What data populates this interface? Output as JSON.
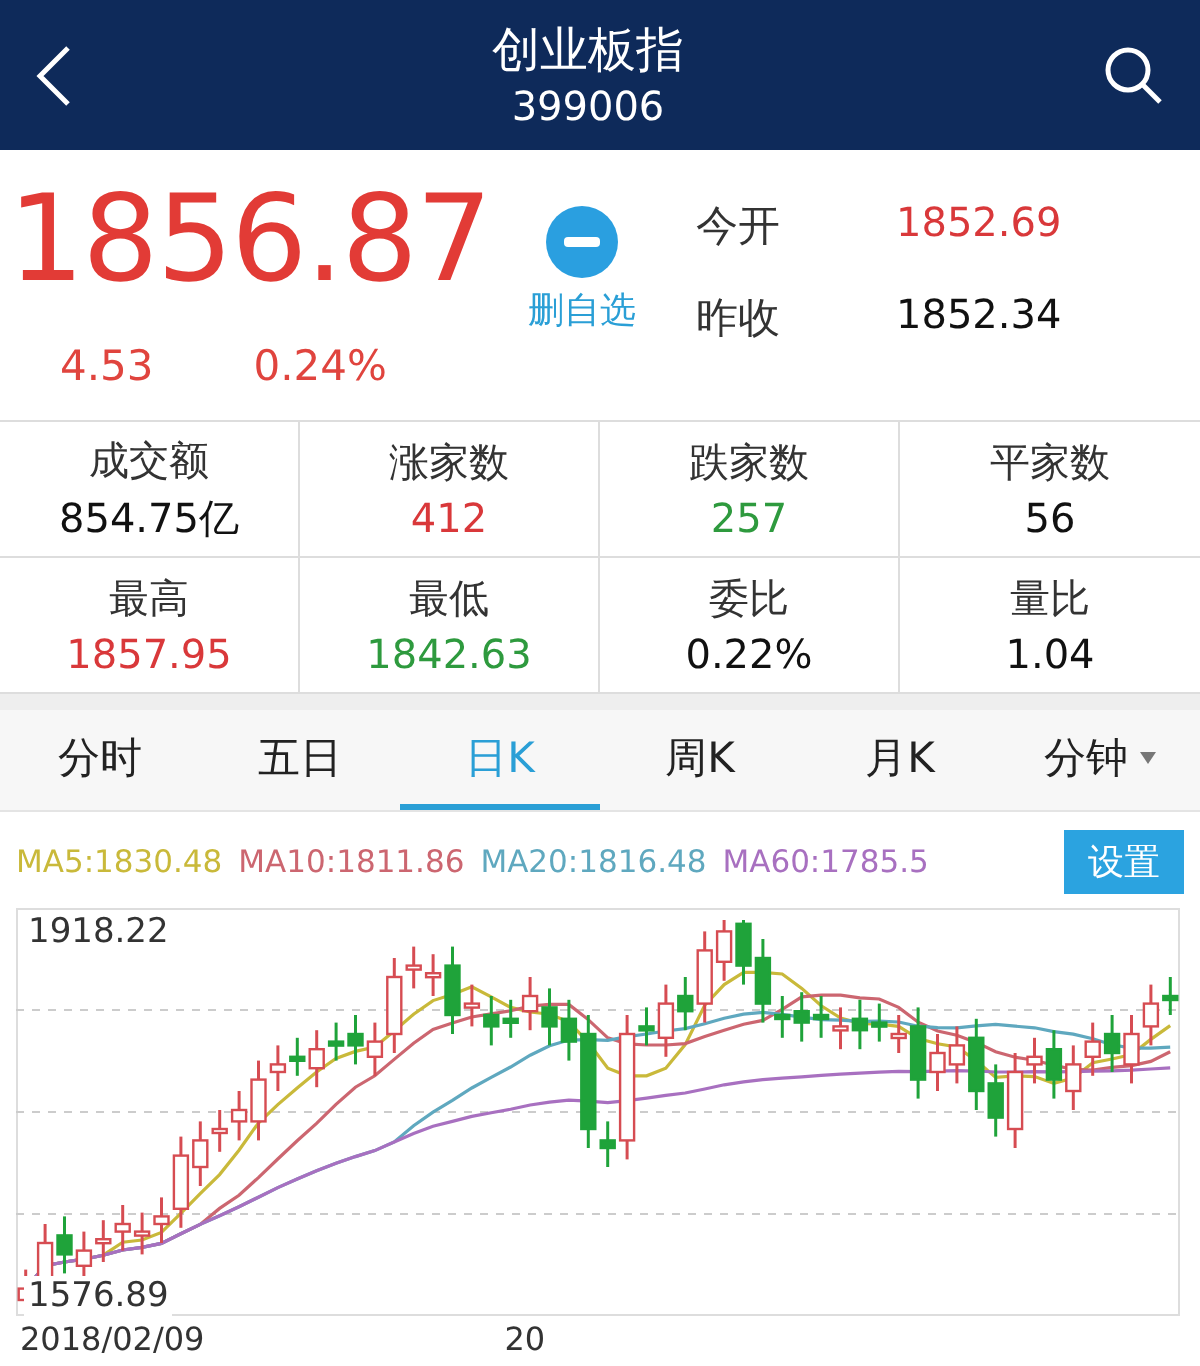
{
  "header": {
    "title": "创业板指",
    "code": "399006"
  },
  "quote": {
    "price": "1856.87",
    "change": "4.53",
    "change_pct": "0.24%",
    "watch_action": "删自选",
    "stats": [
      {
        "label": "今开",
        "value": "1852.69",
        "color": "#d9383a"
      },
      {
        "label": "昨收",
        "value": "1852.34",
        "color": "#111111"
      }
    ]
  },
  "grid": [
    {
      "label": "成交额",
      "value": "854.75亿",
      "color": "#111111"
    },
    {
      "label": "涨家数",
      "value": "412",
      "color": "#d9383a"
    },
    {
      "label": "跌家数",
      "value": "257",
      "color": "#2e9a3e"
    },
    {
      "label": "平家数",
      "value": "56",
      "color": "#111111"
    },
    {
      "label": "最高",
      "value": "1857.95",
      "color": "#d9383a"
    },
    {
      "label": "最低",
      "value": "1842.63",
      "color": "#2e9a3e"
    },
    {
      "label": "委比",
      "value": "0.22%",
      "color": "#111111"
    },
    {
      "label": "量比",
      "value": "1.04",
      "color": "#111111"
    }
  ],
  "tabs": [
    {
      "label": "分时",
      "selected": false,
      "dropdown": false
    },
    {
      "label": "五日",
      "selected": false,
      "dropdown": false
    },
    {
      "label": "日K",
      "selected": true,
      "dropdown": false
    },
    {
      "label": "周K",
      "selected": false,
      "dropdown": false
    },
    {
      "label": "月K",
      "selected": false,
      "dropdown": false
    },
    {
      "label": "分钟",
      "selected": false,
      "dropdown": true
    }
  ],
  "chart": {
    "ma_legend": [
      {
        "label": "MA5:1830.48",
        "color": "#c9b93a"
      },
      {
        "label": "MA10:1811.86",
        "color": "#cc6670"
      },
      {
        "label": "MA20:1816.48",
        "color": "#5fa8bf"
      },
      {
        "label": "MA60:1785.5",
        "color": "#a870c0"
      }
    ],
    "settings_button": "设置",
    "y_max_label": "1918.22",
    "y_min_label": "1576.89",
    "x_labels": [
      "2018/02/09",
      "20"
    ]
  }
}
